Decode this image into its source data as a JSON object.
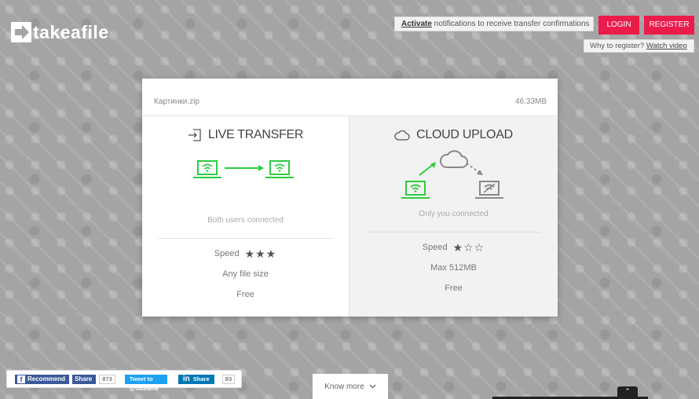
{
  "header": {
    "logo_text": "takeafile",
    "notify_link": "Activate",
    "notify_text": " notifications to receive transfer confirmations",
    "login_label": "LOGIN",
    "register_label": "REGISTER",
    "why_text": "Why to register? ",
    "why_link": "Watch video"
  },
  "file": {
    "name": "Картинки.zip",
    "size": "46.33MB"
  },
  "live": {
    "title": "LIVE TRANSFER",
    "status": "Both users connected",
    "speed_label": "Speed",
    "speed_stars": "★★★",
    "size_text": "Any file size",
    "price_text": "Free",
    "speed_rating": 3
  },
  "cloud": {
    "title": "CLOUD UPLOAD",
    "status": "Only you connected",
    "speed_label": "Speed",
    "speed_stars": "★☆☆",
    "size_text": "Max 512MB",
    "price_text": "Free",
    "speed_rating": 1
  },
  "social": {
    "fb_label": "Recommend",
    "fb_share": "Share",
    "fb_count": "873",
    "tw_label": "Tweet to @takeafile",
    "li_label": "Share",
    "li_count": "83"
  },
  "footer": {
    "know_more": "Know more"
  },
  "colors": {
    "accent_green": "#2ecc40",
    "brand_red": "#ec1c4a",
    "bg_gray": "#a4a4a4"
  }
}
